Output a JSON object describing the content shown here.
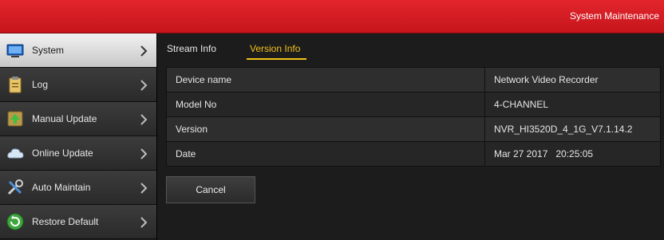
{
  "header": {
    "title": "System Maintenance"
  },
  "sidebar": {
    "items": [
      {
        "label": "System",
        "icon": "monitor-icon",
        "active": true
      },
      {
        "label": "Log",
        "icon": "clipboard-icon",
        "active": false
      },
      {
        "label": "Manual Update",
        "icon": "upload-icon",
        "active": false
      },
      {
        "label": "Online Update",
        "icon": "cloud-icon",
        "active": false
      },
      {
        "label": "Auto Maintain",
        "icon": "tools-icon",
        "active": false
      },
      {
        "label": "Restore Default",
        "icon": "refresh-icon",
        "active": false
      }
    ]
  },
  "tabs": [
    {
      "label": "Stream Info",
      "active": false
    },
    {
      "label": "Version Info",
      "active": true
    }
  ],
  "info": {
    "rows": [
      {
        "label": "Device name",
        "value": "Network Video Recorder"
      },
      {
        "label": "Model No",
        "value": "4-CHANNEL"
      },
      {
        "label": "Version",
        "value": "NVR_HI3520D_4_1G_V7.1.14.2"
      },
      {
        "label": "Date",
        "value": "Mar 27 2017   20:25:05"
      }
    ]
  },
  "actions": {
    "cancel_label": "Cancel"
  },
  "colors": {
    "header": "#d81d24",
    "active_tab": "#f2c21a"
  }
}
